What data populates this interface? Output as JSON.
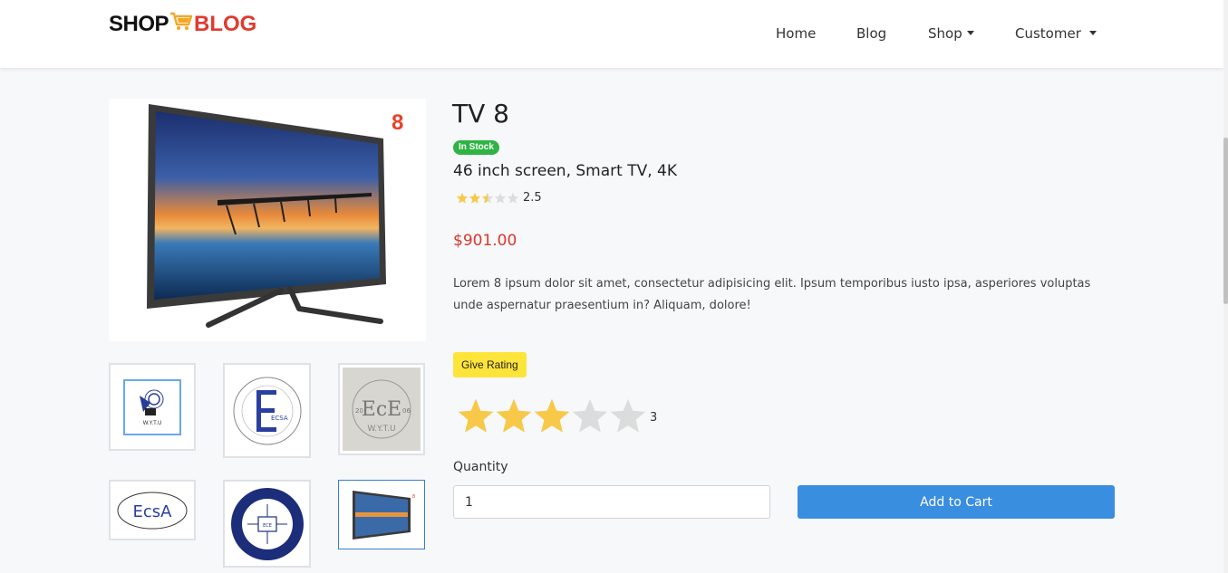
{
  "brand": {
    "shop": "SHOP",
    "blog": "BLOG",
    "cart_icon": "shopping-cart-icon",
    "blog_color": "#e03a2f"
  },
  "nav": [
    {
      "label": "Home",
      "dropdown": false
    },
    {
      "label": "Blog",
      "dropdown": false
    },
    {
      "label": "Shop",
      "dropdown": true
    },
    {
      "label": "Customer",
      "dropdown": true
    }
  ],
  "product": {
    "title": "TV 8",
    "stock_badge": "In Stock",
    "subtitle": "46 inch screen, Smart TV, 4K",
    "rating": 2.5,
    "rating_label": "2.5",
    "price": "$901.00",
    "main_image_label": "8",
    "description": "Lorem 8 ipsum dolor sit amet, consectetur adipisicing elit. Ipsum temporibus iusto ipsa, asperiores voluptas unde aspernatur praesentium in? Aliquam, dolore!"
  },
  "thumbnails": [
    {
      "label": "W.Y.T.U"
    },
    {
      "label": "ECSA"
    },
    {
      "label": "EcE",
      "year_left": "20",
      "year_right": "06",
      "sub": "W.Y.T.U"
    },
    {
      "label": "EcsA"
    },
    {
      "label": "ECE"
    },
    {
      "label": "TV 8"
    }
  ],
  "user_rating": {
    "button_label": "Give Rating",
    "value": 3,
    "value_label": "3",
    "max": 5
  },
  "quantity": {
    "label": "Quantity",
    "value": "1"
  },
  "add_to_cart": "Add to Cart",
  "colors": {
    "badge": "#2fb344",
    "price": "#d9362a",
    "star": "#f8c948",
    "star_empty": "#dcdcdc",
    "primary": "#3a8ee0",
    "rating_button": "#fde43a"
  }
}
